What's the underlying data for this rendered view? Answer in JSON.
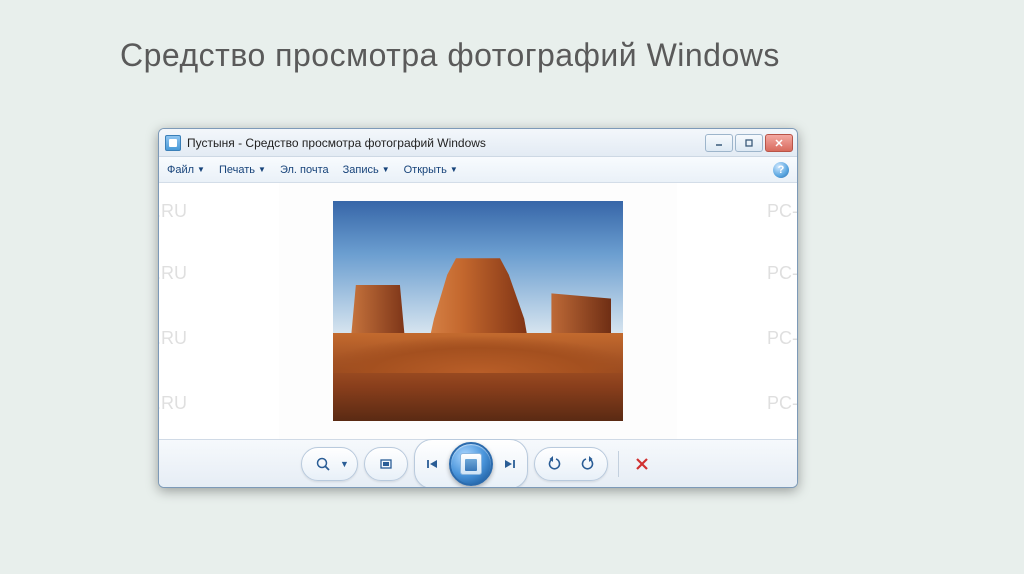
{
  "slide": {
    "title": "Средство просмотра фотографий Windows"
  },
  "window": {
    "title": "Пустыня - Средство просмотра фотографий Windows"
  },
  "menu": {
    "file": "Файл",
    "print": "Печать",
    "email": "Эл. почта",
    "burn": "Запись",
    "open": "Открыть"
  },
  "controls": {
    "zoom": "zoom",
    "fit": "fit-to-window",
    "prev": "previous",
    "slideshow": "slideshow",
    "next": "next",
    "rotate_ccw": "rotate-counterclockwise",
    "rotate_cw": "rotate-clockwise",
    "delete": "delete"
  },
  "watermark": "PC-Problems.RU",
  "image": {
    "name": "Пустыня"
  }
}
